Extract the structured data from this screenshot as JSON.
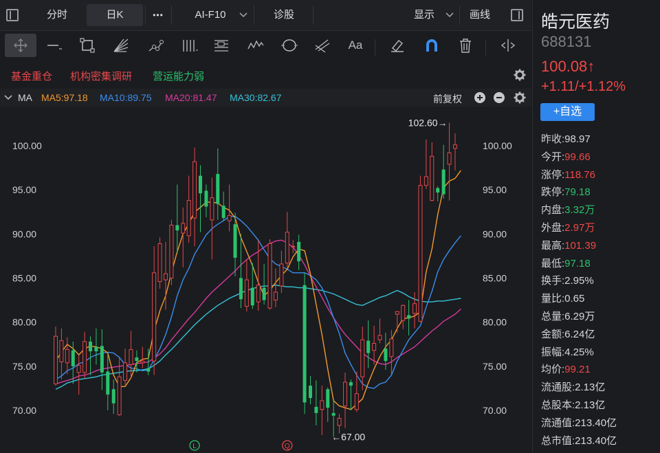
{
  "top_tabs": {
    "fenshi": "分时",
    "rik": "日K",
    "more": "•••",
    "f10": "AI-F10",
    "zhengu": "诊股",
    "display": "显示",
    "drawline": "画线"
  },
  "toolbar": {
    "text_tool_label": "Aa",
    "icons": [
      "crosshair-icon",
      "line-icon",
      "rect-icon",
      "fan-icon",
      "node-line-icon",
      "parallel-lines-icon",
      "channel-icon",
      "wave-icon",
      "ellipse-icon",
      "fork-icon",
      "text-icon",
      "eraser-icon",
      "magnet-icon",
      "trash-icon",
      "scroll-icon"
    ]
  },
  "tags": [
    {
      "label": "基金重仓",
      "color": "#e5484d"
    },
    {
      "label": "机构密集调研",
      "color": "#e5484d"
    },
    {
      "label": "营运能力弱",
      "color": "#2bc26e"
    }
  ],
  "ma_header": {
    "name": "MA",
    "ma5": "MA5:97.18",
    "ma10": "MA10:89.75",
    "ma20": "MA20:81.47",
    "ma30": "MA30:82.67",
    "adjust": "前复权",
    "colors": {
      "ma5": "#f29a2e",
      "ma10": "#3a8ef0",
      "ma20": "#d63aa0",
      "ma30": "#35c3d8"
    }
  },
  "chart_data": {
    "type": "candlestick",
    "y_ticks": [
      "100.00",
      "95.00",
      "90.00",
      "85.00",
      "80.00",
      "75.00",
      "70.00"
    ],
    "ylim": [
      67,
      103
    ],
    "high_annotation": "102.60→",
    "low_annotation": "←67.00",
    "markers": [
      "L",
      "Q"
    ],
    "candles": [
      {
        "o": 73.0,
        "h": 79.5,
        "l": 72.8,
        "c": 78.4
      },
      {
        "o": 75.5,
        "h": 79.3,
        "l": 73.5,
        "c": 77.9
      },
      {
        "o": 75.4,
        "h": 78.3,
        "l": 74.1,
        "c": 76.9
      },
      {
        "o": 76.8,
        "h": 77.8,
        "l": 73.0,
        "c": 75.0
      },
      {
        "o": 74.3,
        "h": 76.3,
        "l": 71.8,
        "c": 75.1
      },
      {
        "o": 74.3,
        "h": 78.9,
        "l": 73.6,
        "c": 77.8
      },
      {
        "o": 77.8,
        "h": 78.4,
        "l": 74.0,
        "c": 76.7
      },
      {
        "o": 77.2,
        "h": 79.3,
        "l": 75.2,
        "c": 76.7
      },
      {
        "o": 77.3,
        "h": 79.2,
        "l": 72.3,
        "c": 74.3
      },
      {
        "o": 74.4,
        "h": 76.5,
        "l": 70.0,
        "c": 71.8
      },
      {
        "o": 72.4,
        "h": 73.5,
        "l": 69.6,
        "c": 70.8
      },
      {
        "o": 69.5,
        "h": 76.1,
        "l": 69.4,
        "c": 73.8
      },
      {
        "o": 73.4,
        "h": 77.0,
        "l": 72.9,
        "c": 75.4
      },
      {
        "o": 75.2,
        "h": 79.0,
        "l": 73.6,
        "c": 76.9
      },
      {
        "o": 76.0,
        "h": 76.8,
        "l": 74.3,
        "c": 75.6
      },
      {
        "o": 75.4,
        "h": 77.2,
        "l": 74.8,
        "c": 75.6
      },
      {
        "o": 74.8,
        "h": 77.0,
        "l": 74.0,
        "c": 74.4
      },
      {
        "o": 75.6,
        "h": 88.6,
        "l": 74.0,
        "c": 85.6
      },
      {
        "o": 84.6,
        "h": 89.6,
        "l": 83.8,
        "c": 88.9
      },
      {
        "o": 84.8,
        "h": 89.1,
        "l": 81.4,
        "c": 85.5
      },
      {
        "o": 85.0,
        "h": 91.6,
        "l": 84.2,
        "c": 91.0
      },
      {
        "o": 91.0,
        "h": 95.6,
        "l": 87.8,
        "c": 90.4
      },
      {
        "o": 90.1,
        "h": 93.0,
        "l": 86.2,
        "c": 91.2
      },
      {
        "o": 89.8,
        "h": 96.6,
        "l": 89.0,
        "c": 93.8
      },
      {
        "o": 91.8,
        "h": 99.8,
        "l": 88.6,
        "c": 98.2
      },
      {
        "o": 96.6,
        "h": 97.8,
        "l": 90.2,
        "c": 94.6
      },
      {
        "o": 94.9,
        "h": 95.6,
        "l": 91.9,
        "c": 93.1
      },
      {
        "o": 91.6,
        "h": 96.4,
        "l": 87.1,
        "c": 94.1
      },
      {
        "o": 96.8,
        "h": 99.7,
        "l": 91.6,
        "c": 93.4
      },
      {
        "o": 93.2,
        "h": 94.8,
        "l": 91.5,
        "c": 91.8
      },
      {
        "o": 91.5,
        "h": 95.6,
        "l": 90.3,
        "c": 92.1
      },
      {
        "o": 91.1,
        "h": 92.4,
        "l": 85.2,
        "c": 87.3
      },
      {
        "o": 85.0,
        "h": 90.0,
        "l": 81.6,
        "c": 82.6
      },
      {
        "o": 81.8,
        "h": 87.1,
        "l": 81.2,
        "c": 84.8
      },
      {
        "o": 83.9,
        "h": 86.7,
        "l": 81.5,
        "c": 81.9
      },
      {
        "o": 82.3,
        "h": 89.3,
        "l": 81.3,
        "c": 84.2
      },
      {
        "o": 83.9,
        "h": 86.6,
        "l": 82.0,
        "c": 82.5
      },
      {
        "o": 81.6,
        "h": 89.4,
        "l": 81.4,
        "c": 88.9
      },
      {
        "o": 82.5,
        "h": 86.1,
        "l": 81.7,
        "c": 83.4
      },
      {
        "o": 84.1,
        "h": 88.1,
        "l": 83.3,
        "c": 86.6
      },
      {
        "o": 86.7,
        "h": 92.5,
        "l": 86.2,
        "c": 90.2
      },
      {
        "o": 88.6,
        "h": 89.3,
        "l": 87.8,
        "c": 88.6
      },
      {
        "o": 89.1,
        "h": 89.9,
        "l": 85.9,
        "c": 86.9
      },
      {
        "o": 84.2,
        "h": 85.6,
        "l": 69.6,
        "c": 70.9
      },
      {
        "o": 72.8,
        "h": 73.9,
        "l": 70.7,
        "c": 71.4
      },
      {
        "o": 70.4,
        "h": 73.4,
        "l": 68.3,
        "c": 69.7
      },
      {
        "o": 70.1,
        "h": 72.8,
        "l": 67.2,
        "c": 71.1
      },
      {
        "o": 72.4,
        "h": 72.6,
        "l": 68.7,
        "c": 70.3
      },
      {
        "o": 69.7,
        "h": 71.2,
        "l": 67.0,
        "c": 69.4
      },
      {
        "o": 68.3,
        "h": 69.6,
        "l": 67.4,
        "c": 69.1
      },
      {
        "o": 70.5,
        "h": 74.3,
        "l": 68.0,
        "c": 73.2
      },
      {
        "o": 73.2,
        "h": 73.5,
        "l": 70.0,
        "c": 72.8
      },
      {
        "o": 70.1,
        "h": 74.4,
        "l": 69.8,
        "c": 71.9
      },
      {
        "o": 73.8,
        "h": 79.5,
        "l": 72.3,
        "c": 78.0
      },
      {
        "o": 77.9,
        "h": 80.2,
        "l": 74.8,
        "c": 76.5
      },
      {
        "o": 76.8,
        "h": 79.6,
        "l": 75.2,
        "c": 77.6
      },
      {
        "o": 78.0,
        "h": 80.4,
        "l": 77.6,
        "c": 78.5
      },
      {
        "o": 77.0,
        "h": 78.8,
        "l": 74.6,
        "c": 75.6
      },
      {
        "o": 76.1,
        "h": 79.1,
        "l": 74.1,
        "c": 78.1
      },
      {
        "o": 80.9,
        "h": 81.0,
        "l": 78.8,
        "c": 81.2
      },
      {
        "o": 80.2,
        "h": 82.0,
        "l": 79.2,
        "c": 81.9
      },
      {
        "o": 80.8,
        "h": 82.5,
        "l": 78.5,
        "c": 80.4
      },
      {
        "o": 81.0,
        "h": 83.4,
        "l": 79.3,
        "c": 82.1
      },
      {
        "o": 80.1,
        "h": 96.6,
        "l": 80.0,
        "c": 95.5
      },
      {
        "o": 95.5,
        "h": 100.7,
        "l": 95.1,
        "c": 96.5
      },
      {
        "o": 93.8,
        "h": 100.4,
        "l": 93.7,
        "c": 98.8
      },
      {
        "o": 95.2,
        "h": 95.4,
        "l": 93.7,
        "c": 94.7
      },
      {
        "o": 97.3,
        "h": 100.1,
        "l": 94.0,
        "c": 94.5
      },
      {
        "o": 97.9,
        "h": 102.6,
        "l": 93.8,
        "c": 99.2
      },
      {
        "o": 99.7,
        "h": 101.4,
        "l": 97.2,
        "c": 100.1
      }
    ],
    "ma5": [
      75.6,
      76.6,
      77.5,
      77.0,
      76.3,
      77.0,
      77.3,
      77.2,
      77.0,
      76.5,
      74.0,
      72.7,
      72.7,
      73.7,
      75.4,
      75.8,
      75.9,
      79.0,
      81.3,
      83.0,
      85.6,
      88.0,
      90.0,
      91.2,
      92.5,
      93.0,
      93.6,
      93.6,
      93.5,
      93.0,
      92.7,
      91.8,
      89.6,
      88.0,
      86.4,
      84.5,
      83.0,
      83.6,
      84.5,
      85.3,
      86.0,
      87.4,
      88.3,
      88.1,
      85.5,
      82.0,
      78.6,
      74.7,
      71.1,
      70.5,
      70.3,
      70.1,
      70.7,
      71.3,
      73.1,
      74.7,
      76.1,
      77.2,
      78.0,
      79.3,
      80.4,
      80.5,
      80.7,
      81.2,
      85.7,
      88.3,
      92.2,
      95.2,
      96.0,
      96.3,
      97.2
    ],
    "ma10": [
      73.5,
      73.9,
      74.5,
      74.8,
      75.3,
      75.5,
      76.0,
      76.3,
      76.5,
      76.6,
      76.5,
      76.0,
      75.2,
      74.8,
      74.7,
      74.5,
      74.6,
      75.7,
      77.0,
      78.6,
      80.6,
      83.0,
      84.8,
      86.1,
      87.7,
      88.8,
      89.9,
      90.6,
      91.1,
      91.5,
      92.0,
      92.0,
      91.5,
      90.9,
      90.1,
      89.3,
      88.2,
      87.2,
      86.6,
      86.3,
      86.0,
      85.6,
      85.6,
      85.6,
      85.3,
      84.8,
      83.9,
      82.4,
      80.5,
      78.7,
      76.5,
      75.2,
      74.0,
      73.0,
      72.6,
      72.5,
      73.0,
      73.2,
      74.0,
      75.6,
      76.8,
      78.0,
      78.8,
      79.6,
      81.7,
      83.5,
      85.7,
      87.1,
      88.1,
      89.0,
      89.8
    ],
    "ma20": [
      73.0,
      73.2,
      73.4,
      73.6,
      73.9,
      74.0,
      74.2,
      74.5,
      74.7,
      74.8,
      74.9,
      75.0,
      75.1,
      75.2,
      75.3,
      75.4,
      75.5,
      75.9,
      76.4,
      77.1,
      78.0,
      78.8,
      79.6,
      80.4,
      81.1,
      81.9,
      82.7,
      83.4,
      84.0,
      84.6,
      85.2,
      85.8,
      86.5,
      87.1,
      87.6,
      88.0,
      88.5,
      88.9,
      89.2,
      89.3,
      89.0,
      88.5,
      87.6,
      86.5,
      85.2,
      84.0,
      82.8,
      81.6,
      80.5,
      79.5,
      78.6,
      77.9,
      77.2,
      76.5,
      76.0,
      75.6,
      75.3,
      75.2,
      75.5,
      76.0,
      76.4,
      76.8,
      77.2,
      77.8,
      78.4,
      79.0,
      79.5,
      80.1,
      80.5,
      80.9,
      81.5
    ],
    "ma30": [
      72.4,
      72.7,
      73.1,
      73.3,
      73.5,
      73.6,
      73.7,
      73.8,
      74.0,
      74.1,
      74.2,
      74.3,
      74.4,
      74.5,
      74.5,
      74.6,
      74.7,
      75.1,
      75.6,
      76.3,
      76.9,
      77.6,
      78.3,
      79.0,
      79.7,
      80.3,
      80.9,
      81.4,
      81.9,
      82.3,
      82.7,
      83.0,
      83.3,
      83.6,
      83.8,
      84.0,
      84.1,
      84.1,
      84.2,
      84.1,
      84.0,
      84.0,
      83.9,
      83.9,
      83.8,
      83.7,
      83.6,
      83.4,
      83.2,
      82.9,
      82.6,
      82.3,
      82.0,
      81.9,
      82.2,
      82.5,
      82.8,
      83.0,
      83.3,
      83.6,
      83.3,
      82.9,
      82.6,
      82.4,
      82.3,
      82.3,
      82.4,
      82.4,
      82.5,
      82.6,
      82.7
    ]
  },
  "quote": {
    "name": "皓元医药",
    "code": "688131",
    "price": "100.08↑",
    "change": "+1.11/+1.12%",
    "watch_button": "+自选",
    "rows": [
      {
        "label": "昨收:",
        "value": "98.97",
        "tone": "white"
      },
      {
        "label": "今开:",
        "value": "99.66",
        "tone": "red"
      },
      {
        "label": "涨停:",
        "value": "118.76",
        "tone": "red"
      },
      {
        "label": "跌停:",
        "value": "79.18",
        "tone": "green"
      },
      {
        "label": "内盘:",
        "value": "3.32万",
        "tone": "green"
      },
      {
        "label": "外盘:",
        "value": "2.97万",
        "tone": "red"
      },
      {
        "label": "最高:",
        "value": "101.39",
        "tone": "red"
      },
      {
        "label": "最低:",
        "value": "97.18",
        "tone": "green"
      },
      {
        "label": "换手:",
        "value": "2.95%",
        "tone": "white"
      },
      {
        "label": "量比:",
        "value": "0.65",
        "tone": "white"
      },
      {
        "label": "总量:",
        "value": "6.29万",
        "tone": "white"
      },
      {
        "label": "金额:",
        "value": "6.24亿",
        "tone": "white"
      },
      {
        "label": "振幅:",
        "value": "4.25%",
        "tone": "white"
      },
      {
        "label": "均价:",
        "value": "99.21",
        "tone": "red"
      },
      {
        "label": "流通股:",
        "value": "2.13亿",
        "tone": "white"
      },
      {
        "label": "总股本:",
        "value": "2.13亿",
        "tone": "white"
      },
      {
        "label": "流通值:",
        "value": "213.40亿",
        "tone": "white"
      },
      {
        "label": "总市值:",
        "value": "213.40亿",
        "tone": "white"
      }
    ]
  }
}
